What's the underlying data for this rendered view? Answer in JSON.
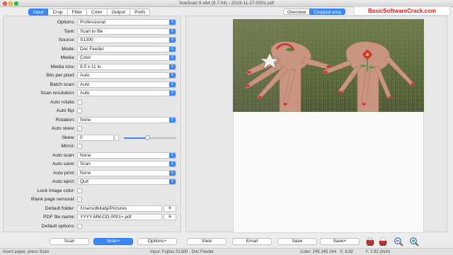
{
  "window": {
    "title": "VueScan 9 x64 (9.7.04) - 2019-11-27-0001.pdf"
  },
  "tabs": [
    {
      "label": "Input",
      "active": true
    },
    {
      "label": "Crop",
      "active": false
    },
    {
      "label": "Filter",
      "active": false
    },
    {
      "label": "Color",
      "active": false
    },
    {
      "label": "Output",
      "active": false
    },
    {
      "label": "Prefs",
      "active": false
    }
  ],
  "settings": {
    "options": {
      "label": "Options:",
      "value": "Professional"
    },
    "task": {
      "label": "Task:",
      "value": "Scan to file"
    },
    "source": {
      "label": "Source:",
      "value": "S1300"
    },
    "mode": {
      "label": "Mode:",
      "value": "Doc Feeder"
    },
    "media": {
      "label": "Media:",
      "value": "Color"
    },
    "media_size": {
      "label": "Media size:",
      "value": "8.5 x 11 in."
    },
    "bits_per_pixel": {
      "label": "Bits per pixel:",
      "value": "Auto"
    },
    "batch_scan": {
      "label": "Batch scan:",
      "value": "Auto"
    },
    "scan_resolution": {
      "label": "Scan resolution:",
      "value": "Auto"
    },
    "auto_rotate": {
      "label": "Auto rotate:"
    },
    "auto_flip": {
      "label": "Auto flip:"
    },
    "rotation": {
      "label": "Rotation:",
      "value": "None"
    },
    "auto_skew": {
      "label": "Auto skew:"
    },
    "skew": {
      "label": "Skew:",
      "value": "0",
      "slider_level": 0.45
    },
    "mirror": {
      "label": "Mirror:"
    },
    "auto_scan": {
      "label": "Auto scan:",
      "value": "None"
    },
    "auto_save": {
      "label": "Auto save:",
      "value": "Scan"
    },
    "auto_print": {
      "label": "Auto print:",
      "value": "None"
    },
    "auto_eject": {
      "label": "Auto eject:",
      "value": "Quit"
    },
    "lock_image_color": {
      "label": "Lock image color:"
    },
    "blank_page_removal": {
      "label": "Blank page removal:"
    },
    "default_folder": {
      "label": "Default folder:",
      "value": "/Users/dkitabji/Pictures",
      "button": "⊕"
    },
    "pdf_file_name": {
      "label": "PDF file name:",
      "value": "YYYY-MM-DD-0001+.pdf",
      "button": "⊕"
    },
    "default_options": {
      "label": "Default options:"
    }
  },
  "view_tabs": [
    {
      "label": "Overview",
      "active": false
    },
    {
      "label": "Cropped area",
      "active": true
    }
  ],
  "watermark": "BasicSoftwareCrack.com",
  "buttons": {
    "scan": "Scan",
    "scan_plus": "Scan+",
    "options_plus": "Options+",
    "view": "View",
    "email": "Email",
    "save": "Save",
    "save_plus": "Save+"
  },
  "status": {
    "left": "Insert paper, press Scan",
    "input": "Input: Fujitsu S1300 - Doc Feeder",
    "color": "Color: 245 245 244",
    "x": "X:  8.82",
    "y": "Y:  2.92 (inch)"
  },
  "colors": {
    "accent": "#3b87f5",
    "window_bg": "#ececec"
  },
  "icons": [
    "scanner-red-icon",
    "scanner-print-icon",
    "zoom-out-icon",
    "zoom-in-icon"
  ]
}
